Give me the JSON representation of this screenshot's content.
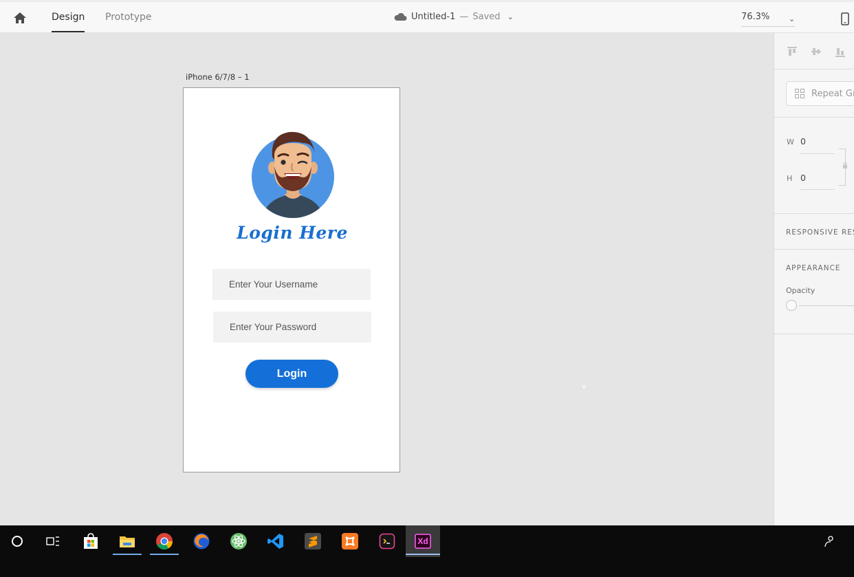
{
  "topbar": {
    "tabs": [
      {
        "label": "Design",
        "active": true
      },
      {
        "label": "Prototype",
        "active": false
      }
    ],
    "doc_name": "Untitled-1",
    "dash": "—",
    "doc_status": "Saved",
    "doc_caret": "⌄",
    "zoom": "76.3%",
    "zoom_caret": "⌄"
  },
  "canvas": {
    "artboard_label": "iPhone 6/7/8 – 1",
    "marker": "v",
    "login_title": "Login Here",
    "username_placeholder": "Enter Your Username",
    "password_placeholder": "Enter Your Password",
    "login_button": "Login",
    "accent_color": "#1470d8",
    "avatar_bg": "#4d95e4"
  },
  "panel": {
    "repeat_grid_label": "Repeat Grid",
    "width_label": "W",
    "width_value": "0",
    "height_label": "H",
    "height_value": "0",
    "responsive_title": "RESPONSIVE RESIZE",
    "appearance_title": "APPEARANCE",
    "opacity_label": "Opacity"
  },
  "taskbar": {
    "apps": [
      "cortana-icon",
      "task-view-icon",
      "store-icon",
      "file-explorer-icon",
      "chrome-icon",
      "firefox-icon",
      "atom-icon",
      "vscode-icon",
      "sublime-icon",
      "xampp-icon",
      "terminal-icon",
      "adobe-xd-icon"
    ],
    "xd_label": "Xd"
  }
}
